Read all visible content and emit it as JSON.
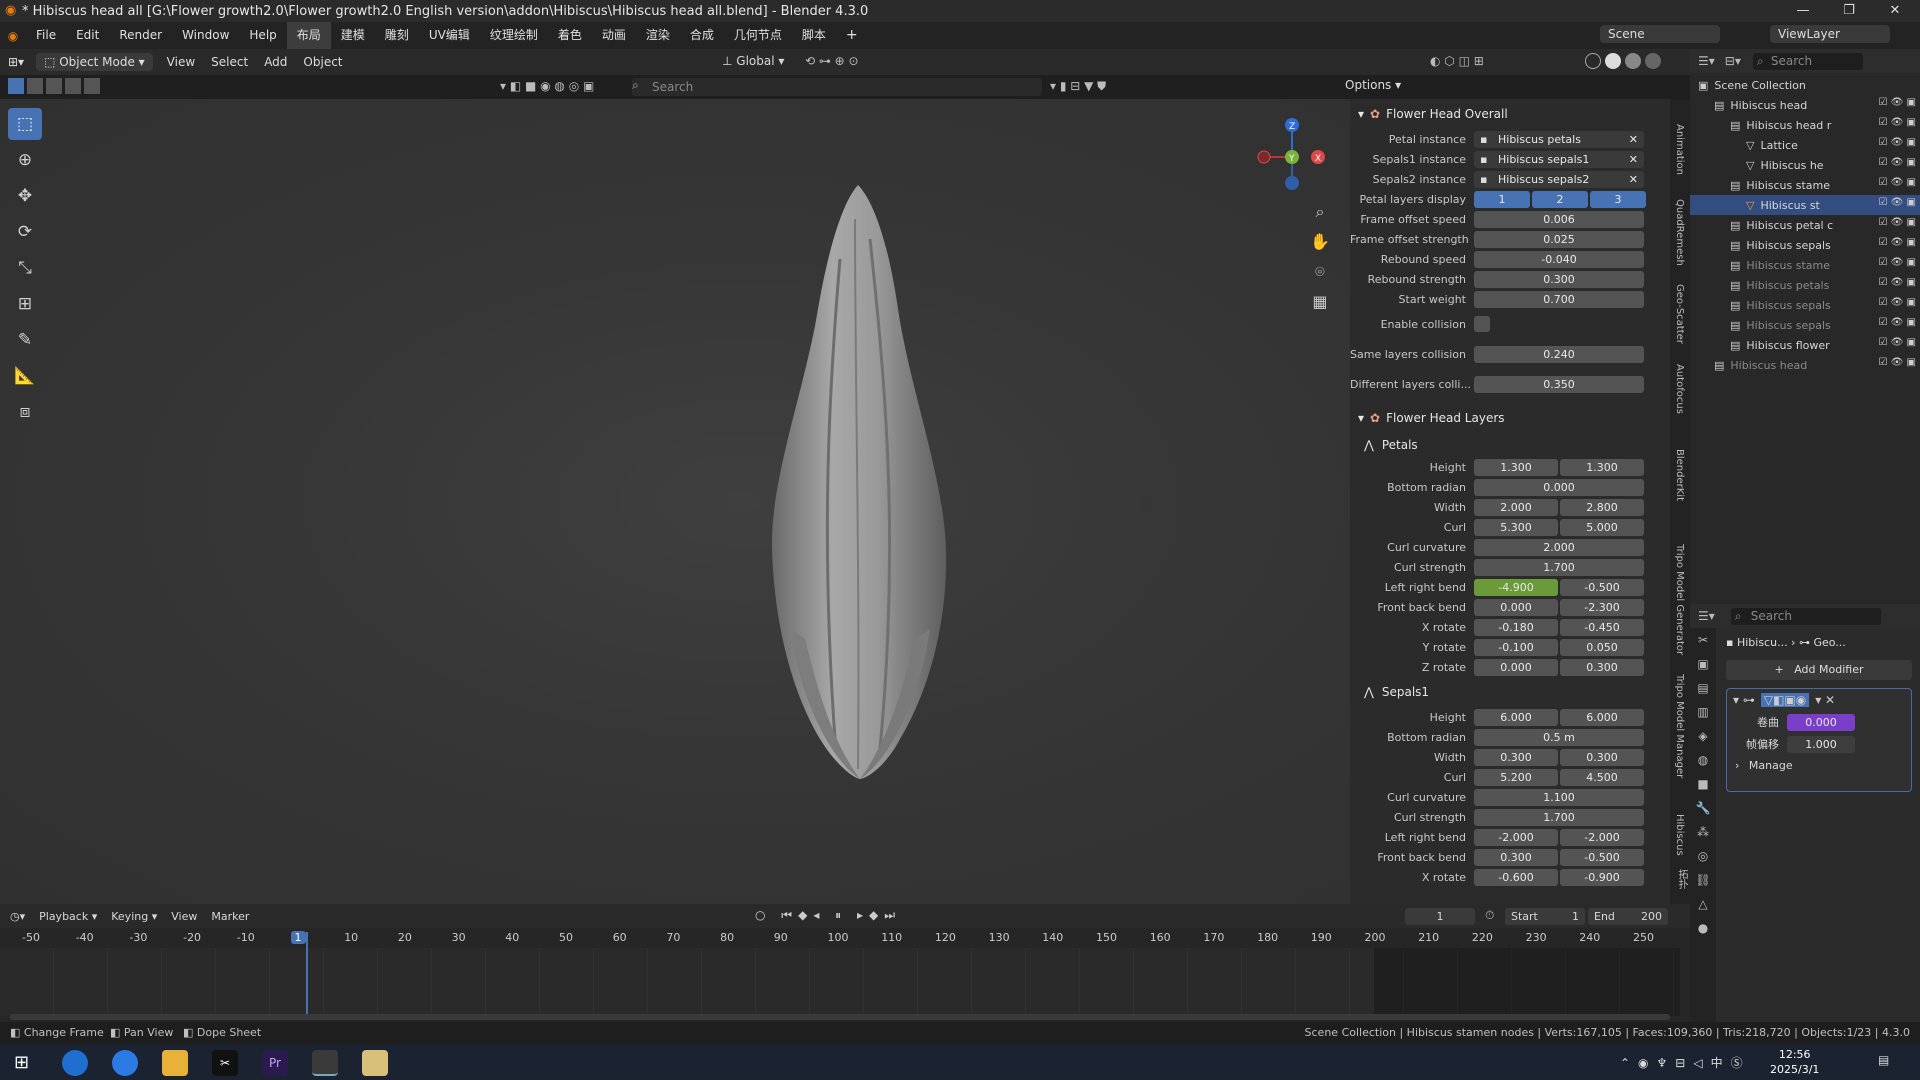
{
  "title": "* Hibiscus head all [G:\\Flower growth2.0\\Flower growth2.0 English version\\addon\\Hibiscus\\Hibiscus head all.blend] - Blender 4.3.0",
  "menu": [
    "File",
    "Edit",
    "Render",
    "Window",
    "Help",
    "布局",
    "建模",
    "雕刻",
    "UV编辑",
    "纹理绘制",
    "着色",
    "动画",
    "渲染",
    "合成",
    "几何节点",
    "脚本"
  ],
  "top_right": {
    "scene": "Scene",
    "viewlayer": "ViewLayer"
  },
  "header": {
    "mode": "Object Mode",
    "view": "View",
    "select": "Select",
    "add": "Add",
    "object": "Object",
    "orient": "Global",
    "search": "Search",
    "options": "Options"
  },
  "npanel": {
    "overall_title": "Flower Head Overall",
    "instances": [
      {
        "label": "Petal instance",
        "value": "Hibiscus petals"
      },
      {
        "label": "Sepals1 instance",
        "value": "Hibiscus sepals1"
      },
      {
        "label": "Sepals2 instance",
        "value": "Hibiscus sepals2"
      }
    ],
    "layers_label": "Petal layers display",
    "layers": [
      "1",
      "2",
      "3"
    ],
    "overall_rows": [
      {
        "label": "Frame offset speed",
        "value": "0.006"
      },
      {
        "label": "Frame offset strength",
        "value": "0.025"
      },
      {
        "label": "Rebound speed",
        "value": "-0.040"
      },
      {
        "label": "Rebound strength",
        "value": "0.300"
      },
      {
        "label": "Start weight",
        "value": "0.700"
      }
    ],
    "collision_label": "Enable collision",
    "collision_rows": [
      {
        "label": "Same layers collision",
        "value": "0.240"
      },
      {
        "label": "Different layers colli...",
        "value": "0.350"
      }
    ],
    "layers_title": "Flower Head Layers",
    "petals_title": "Petals",
    "petals": [
      {
        "label": "Height",
        "a": "1.300",
        "b": "1.300"
      },
      {
        "label": "Bottom radian",
        "a": "0.000"
      },
      {
        "label": "Width",
        "a": "2.000",
        "b": "2.800"
      },
      {
        "label": "Curl",
        "a": "5.300",
        "b": "5.000"
      },
      {
        "label": "Curl curvature",
        "a": "2.000"
      },
      {
        "label": "Curl strength",
        "a": "1.700"
      },
      {
        "label": "Left right bend",
        "a": "-4.900",
        "b": "-0.500",
        "hl": true
      },
      {
        "label": "Front back bend",
        "a": "0.000",
        "b": "-2.300"
      },
      {
        "label": "X rotate",
        "a": "-0.180",
        "b": "-0.450"
      },
      {
        "label": "Y rotate",
        "a": "-0.100",
        "b": "0.050"
      },
      {
        "label": "Z rotate",
        "a": "0.000",
        "b": "0.300"
      }
    ],
    "sepals_title": "Sepals1",
    "sepals": [
      {
        "label": "Height",
        "a": "6.000",
        "b": "6.000"
      },
      {
        "label": "Bottom radian",
        "a": "0.5 m"
      },
      {
        "label": "Width",
        "a": "0.300",
        "b": "0.300"
      },
      {
        "label": "Curl",
        "a": "5.200",
        "b": "4.500"
      },
      {
        "label": "Curl curvature",
        "a": "1.100"
      },
      {
        "label": "Curl strength",
        "a": "1.700"
      },
      {
        "label": "Left right bend",
        "a": "-2.000",
        "b": "-2.000"
      },
      {
        "label": "Front back bend",
        "a": "0.300",
        "b": "-0.500"
      },
      {
        "label": "X rotate",
        "a": "-0.600",
        "b": "-0.900"
      }
    ]
  },
  "vtabs": [
    "Animation",
    "QuadRemesh",
    "Geo-Scatter",
    "Autofocus",
    "BlenderKit",
    "Tripo Model Generator",
    "Tripo Model Manager",
    "Hibiscus",
    "拓扑"
  ],
  "outliner": {
    "search": "Search",
    "rows": [
      {
        "name": "Scene Collection",
        "indent": 0
      },
      {
        "name": "Hibiscus head",
        "indent": 1
      },
      {
        "name": "Hibiscus head r",
        "indent": 2
      },
      {
        "name": "Lattice",
        "indent": 3
      },
      {
        "name": "Hibiscus he",
        "indent": 3
      },
      {
        "name": "Hibiscus stame",
        "indent": 2
      },
      {
        "name": "Hibiscus st",
        "indent": 3,
        "sel": true
      },
      {
        "name": "Hibiscus petal c",
        "indent": 2
      },
      {
        "name": "Hibiscus sepals",
        "indent": 2
      },
      {
        "name": "Hibiscus stame",
        "indent": 2,
        "dim": true
      },
      {
        "name": "Hibiscus petals",
        "indent": 2,
        "dim": true
      },
      {
        "name": "Hibiscus sepals",
        "indent": 2,
        "dim": true
      },
      {
        "name": "Hibiscus sepals",
        "indent": 2,
        "dim": true
      },
      {
        "name": "Hibiscus flower",
        "indent": 2
      },
      {
        "name": "Hibiscus head",
        "indent": 1,
        "dim": true
      }
    ]
  },
  "props": {
    "search": "Search",
    "breadcrumb_obj": "Hibiscu...",
    "breadcrumb_mod": "Geo...",
    "add_modifier": "Add Modifier",
    "mod_rows": [
      {
        "label": "卷曲",
        "value": "0.000"
      },
      {
        "label": "帧偏移",
        "value": "1.000"
      }
    ],
    "manage": "Manage"
  },
  "timeline": {
    "playback": "Playback",
    "keying": "Keying",
    "view": "View",
    "marker": "Marker",
    "current": "1",
    "start_label": "Start",
    "start": "1",
    "end_label": "End",
    "end": "200",
    "ticks": [
      "-50",
      "-40",
      "-30",
      "-20",
      "-10",
      "1",
      "10",
      "20",
      "30",
      "40",
      "50",
      "60",
      "70",
      "80",
      "90",
      "100",
      "110",
      "120",
      "130",
      "140",
      "150",
      "160",
      "170",
      "180",
      "190",
      "200",
      "210",
      "220",
      "230",
      "240",
      "250"
    ]
  },
  "status": {
    "left": [
      "Change Frame",
      "Pan View",
      "Dope Sheet"
    ],
    "right": "Scene Collection | Hibiscus stamen nodes | Verts:167,105 | Faces:109,360 | Tris:218,720 | Objects:1/23 | 4.3.0"
  },
  "clock": {
    "time": "12:56",
    "date": "2025/3/1"
  }
}
